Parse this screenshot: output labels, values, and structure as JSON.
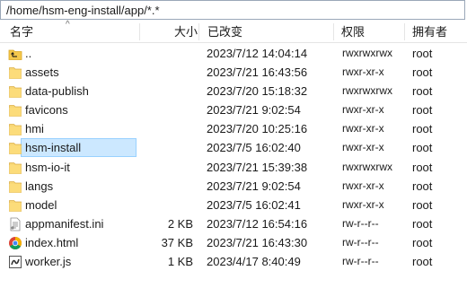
{
  "path": "/home/hsm-eng-install/app/*.*",
  "columns": {
    "name": "名字",
    "size": "大小",
    "modified": "已改变",
    "perms": "权限",
    "owner": "拥有者"
  },
  "rows": [
    {
      "icon": "parent-folder-icon",
      "name": "..",
      "size": "",
      "modified": "2023/7/12 14:04:14",
      "perms": "rwxrwxrwx",
      "owner": "root"
    },
    {
      "icon": "folder-icon",
      "name": "assets",
      "size": "",
      "modified": "2023/7/21 16:43:56",
      "perms": "rwxr-xr-x",
      "owner": "root"
    },
    {
      "icon": "folder-icon",
      "name": "data-publish",
      "size": "",
      "modified": "2023/7/20 15:18:32",
      "perms": "rwxrwxrwx",
      "owner": "root"
    },
    {
      "icon": "folder-icon",
      "name": "favicons",
      "size": "",
      "modified": "2023/7/21 9:02:54",
      "perms": "rwxr-xr-x",
      "owner": "root"
    },
    {
      "icon": "folder-icon",
      "name": "hmi",
      "size": "",
      "modified": "2023/7/20 10:25:16",
      "perms": "rwxr-xr-x",
      "owner": "root"
    },
    {
      "icon": "folder-icon",
      "name": "hsm-install",
      "size": "",
      "modified": "2023/7/5 16:02:40",
      "perms": "rwxr-xr-x",
      "owner": "root",
      "selected": true
    },
    {
      "icon": "folder-icon",
      "name": "hsm-io-it",
      "size": "",
      "modified": "2023/7/21 15:39:38",
      "perms": "rwxrwxrwx",
      "owner": "root"
    },
    {
      "icon": "folder-icon",
      "name": "langs",
      "size": "",
      "modified": "2023/7/21 9:02:54",
      "perms": "rwxr-xr-x",
      "owner": "root"
    },
    {
      "icon": "folder-icon",
      "name": "model",
      "size": "",
      "modified": "2023/7/5 16:02:41",
      "perms": "rwxr-xr-x",
      "owner": "root"
    },
    {
      "icon": "ini-file-icon",
      "name": "appmanifest.ini",
      "size": "2 KB",
      "modified": "2023/7/12 16:54:16",
      "perms": "rw-r--r--",
      "owner": "root"
    },
    {
      "icon": "chrome-html-icon",
      "name": "index.html",
      "size": "37 KB",
      "modified": "2023/7/21 16:43:30",
      "perms": "rw-r--r--",
      "owner": "root"
    },
    {
      "icon": "js-file-icon",
      "name": "worker.js",
      "size": "1 KB",
      "modified": "2023/4/17 8:40:49",
      "perms": "rw-r--r--",
      "owner": "root"
    }
  ]
}
